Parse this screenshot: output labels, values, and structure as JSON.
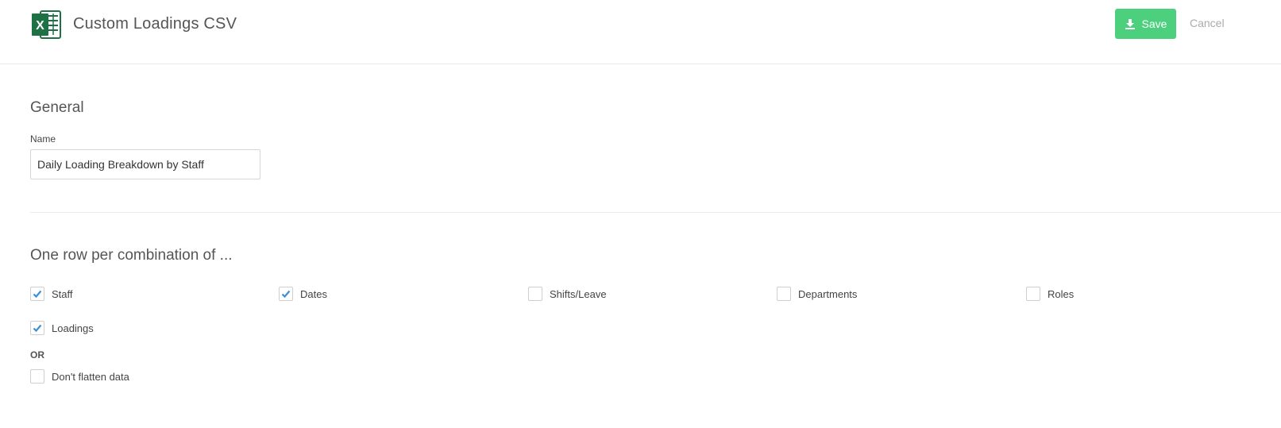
{
  "header": {
    "title": "Custom Loadings CSV",
    "logo_icon": "excel-icon",
    "logo_letter": "X",
    "save_label": "Save",
    "cancel_label": "Cancel"
  },
  "general": {
    "heading": "General",
    "name_label": "Name",
    "name_value": "Daily Loading Breakdown by Staff"
  },
  "combination": {
    "heading": "One row per combination of ...",
    "options": [
      {
        "label": "Staff",
        "checked": true
      },
      {
        "label": "Dates",
        "checked": true
      },
      {
        "label": "Shifts/Leave",
        "checked": false
      },
      {
        "label": "Departments",
        "checked": false
      },
      {
        "label": "Roles",
        "checked": false
      },
      {
        "label": "Loadings",
        "checked": true
      }
    ],
    "or_label": "OR",
    "no_flatten": {
      "label": "Don't flatten data",
      "checked": false
    }
  },
  "colors": {
    "accent_green": "#4cd07d",
    "check_blue": "#3a8fd6",
    "excel_green": "#1e7145"
  }
}
